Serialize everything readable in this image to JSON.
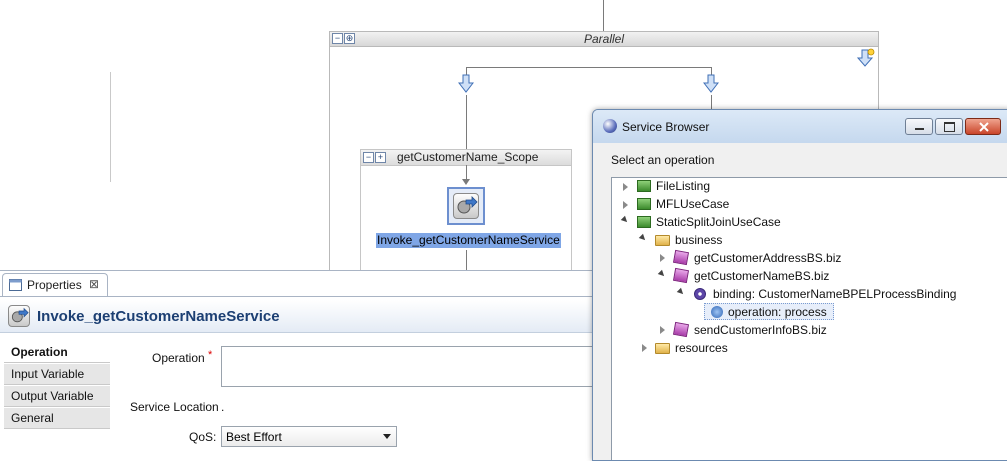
{
  "canvas": {
    "parallel_title": "Parallel",
    "scope_title": "getCustomerName_Scope",
    "invoke_label": "Invoke_getCustomerNameService"
  },
  "properties": {
    "tab_label": "Properties",
    "close_glyph": "⊠",
    "title": "Invoke_getCustomerNameService",
    "tabs": [
      "Operation",
      "Input Variable",
      "Output Variable",
      "General"
    ],
    "active_tab": "Operation",
    "operation_label": "Operation",
    "required_marker": "*",
    "operation_value": "",
    "service_location_label": "Service Location",
    "service_location_value": ".",
    "qos_label": "QoS:",
    "qos_value": "Best Effort"
  },
  "dialog": {
    "title": "Service Browser",
    "instruction": "Select an operation",
    "tree": {
      "file_listing": "FileListing",
      "mfl_use_case": "MFLUseCase",
      "static_split": "StaticSplitJoinUseCase",
      "business": "business",
      "get_address": "getCustomerAddressBS.biz",
      "get_name": "getCustomerNameBS.biz",
      "binding": "binding: CustomerNameBPELProcessBinding",
      "operation": "operation: process",
      "send_info": "sendCustomerInfoBS.biz",
      "resources": "resources"
    }
  },
  "colors": {
    "selection": "#7fa6e6",
    "accent": "#1c3f73",
    "required": "#dd0000"
  }
}
